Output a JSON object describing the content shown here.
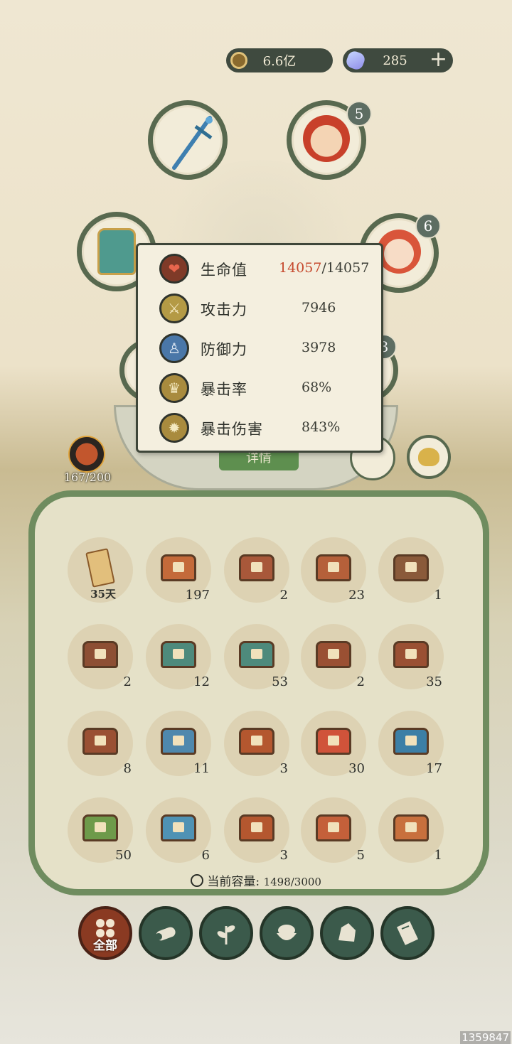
{
  "currency": {
    "coins": "6.6亿",
    "gems": "285",
    "add_label": "+"
  },
  "equipment": {
    "weapon_icon": "sword-icon",
    "hero_badge": "5",
    "armor_icon": "armor-icon",
    "pet_badge": "6",
    "partial_badge": "3"
  },
  "detail_button": "详情",
  "energy": {
    "value": "167/200"
  },
  "stats": [
    {
      "label": "生命值",
      "current": "14057",
      "max": "/14057",
      "icon": "heart-icon"
    },
    {
      "label": "攻击力",
      "value": "7946",
      "icon": "attack-icon"
    },
    {
      "label": "防御力",
      "value": "3978",
      "icon": "defense-icon"
    },
    {
      "label": "暴击率",
      "value": "68%",
      "icon": "crit-rate-icon"
    },
    {
      "label": "暴击伤害",
      "value": "843%",
      "icon": "crit-damage-icon"
    }
  ],
  "inventory": {
    "items": [
      {
        "count": "35天",
        "type": "scroll"
      },
      {
        "count": "197",
        "color": "#c46a3a"
      },
      {
        "count": "2",
        "color": "#a8583a"
      },
      {
        "count": "23",
        "color": "#b5603a"
      },
      {
        "count": "1",
        "color": "#8a5a3a"
      },
      {
        "count": "2",
        "color": "#8d4f34"
      },
      {
        "count": "12",
        "color": "#4e8a7c"
      },
      {
        "count": "53",
        "color": "#4e8a7c"
      },
      {
        "count": "2",
        "color": "#9a5033"
      },
      {
        "count": "35",
        "color": "#9a5033"
      },
      {
        "count": "8",
        "color": "#9a5033"
      },
      {
        "count": "11",
        "color": "#4f88ad"
      },
      {
        "count": "3",
        "color": "#b4572f"
      },
      {
        "count": "30",
        "color": "#d0533a"
      },
      {
        "count": "17",
        "color": "#3c7fa6"
      },
      {
        "count": "50",
        "color": "#6e9a4a"
      },
      {
        "count": "6",
        "color": "#4f92b4"
      },
      {
        "count": "3",
        "color": "#b4572f"
      },
      {
        "count": "5",
        "color": "#c4603a"
      },
      {
        "count": "1",
        "color": "#c8703d"
      }
    ],
    "capacity_label": "当前容量:",
    "capacity_value": "1498/3000"
  },
  "tabs": [
    {
      "label": "全部",
      "icon": "all-grid-icon",
      "active": true
    },
    {
      "label": "",
      "icon": "wood-log-icon"
    },
    {
      "label": "",
      "icon": "herb-icon"
    },
    {
      "label": "",
      "icon": "food-bowl-icon"
    },
    {
      "label": "",
      "icon": "ore-icon"
    },
    {
      "label": "",
      "icon": "scroll-icon"
    }
  ],
  "watermark": "1359847"
}
